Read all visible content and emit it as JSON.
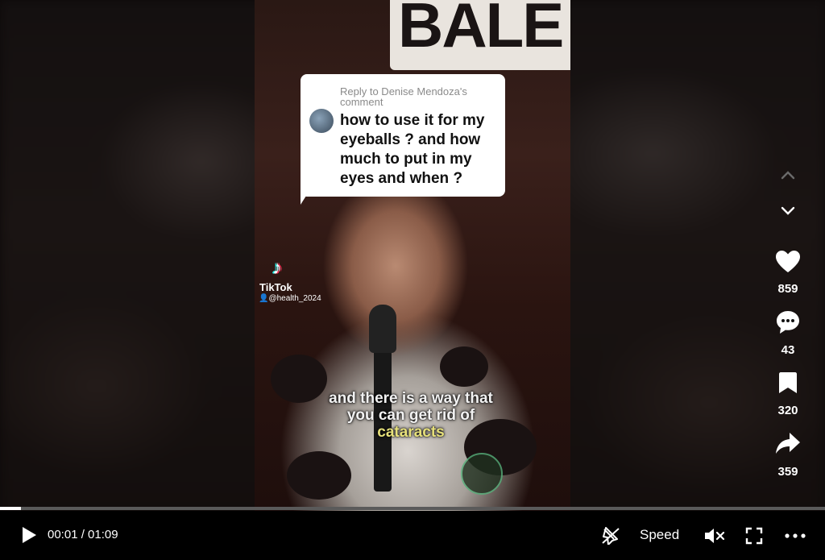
{
  "comment": {
    "header": "Reply to Denise Mendoza's comment",
    "text": "how to use it for my eyeballs ? and how much to put in my eyes and when ?"
  },
  "video": {
    "banner_text": "BALE",
    "watermark_brand": "TikTok",
    "watermark_handle": "@health_2024",
    "caption_line1": "and there is a way that",
    "caption_line2": "you can get rid of",
    "caption_highlight": "cataracts"
  },
  "sidebar": {
    "like_count": "859",
    "comment_count": "43",
    "save_count": "320",
    "share_count": "359"
  },
  "player": {
    "time": "00:01 / 01:09",
    "progress": 0.025,
    "speed_label": "Speed"
  },
  "icons": [
    "chevron-up-icon",
    "chevron-down-icon",
    "heart-icon",
    "comment-icon",
    "bookmark-icon",
    "share-icon",
    "play-icon",
    "pip-icon",
    "mute-icon",
    "fullscreen-icon",
    "more-icon"
  ],
  "colors": {
    "accent_cyan": "#25f4ee",
    "accent_pink": "#fe2c55",
    "caption_highlight": "#e6e07a"
  }
}
